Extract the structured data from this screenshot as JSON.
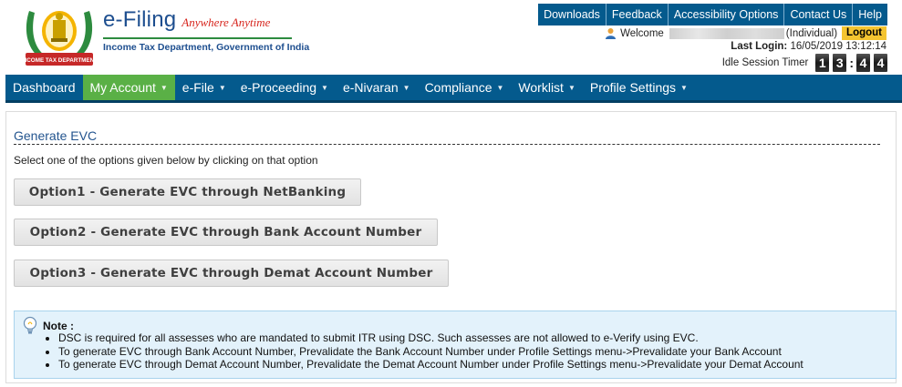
{
  "header": {
    "emblem_caption": "INCOME TAX DEPARTMENT",
    "brand_main": "e-Filing",
    "brand_tagline": "Anywhere Anytime",
    "department": "Income Tax Department, Government of India",
    "top_links": [
      "Downloads",
      "Feedback",
      "Accessibility Options",
      "Contact Us",
      "Help"
    ],
    "welcome_label": "Welcome",
    "user_type": "(Individual)",
    "logout_label": "Logout",
    "last_login_label": "Last Login:",
    "last_login_value": "16/05/2019 13:12:14",
    "idle_label": "Idle Session Timer",
    "idle_digits": [
      "1",
      "3",
      "4",
      "4"
    ],
    "idle_separator": ":"
  },
  "nav": {
    "items": [
      {
        "label": "Dashboard",
        "dropdown": false
      },
      {
        "label": "My Account",
        "dropdown": true
      },
      {
        "label": "e-File",
        "dropdown": true
      },
      {
        "label": "e-Proceeding",
        "dropdown": true
      },
      {
        "label": "e-Nivaran",
        "dropdown": true
      },
      {
        "label": "Compliance",
        "dropdown": true
      },
      {
        "label": "Worklist",
        "dropdown": true
      },
      {
        "label": "Profile Settings",
        "dropdown": true
      }
    ],
    "active_index": 1,
    "caret_glyph": "▼"
  },
  "main": {
    "title": "Generate EVC",
    "instruction": "Select one of the options given below by clicking on that option",
    "options": [
      "Option1 - Generate EVC through NetBanking",
      "Option2 - Generate EVC through Bank Account Number",
      "Option3 - Generate EVC through Demat Account Number"
    ],
    "note": {
      "title": "Note :",
      "items": [
        "DSC is required for all assesses who are mandated to submit ITR using DSC. Such assesses are not allowed to e-Verify using EVC.",
        "To generate EVC through Bank Account Number, Prevalidate the Bank Account Number under Profile Settings menu->Prevalidate your Bank Account",
        "To generate EVC through Demat Account Number, Prevalidate the Demat Account Number under Profile Settings menu->Prevalidate your Demat Account"
      ]
    }
  },
  "colors": {
    "nav_bg": "#045a8d",
    "nav_active": "#5ab046",
    "brand_blue": "#1d4e8f",
    "tagline_red": "#d7261e",
    "logout_bg": "#f4c430",
    "note_bg": "#e3f2fb"
  },
  "icons": {
    "emblem": "government-emblem-icon",
    "user": "user-icon",
    "note": "lightbulb-icon"
  }
}
